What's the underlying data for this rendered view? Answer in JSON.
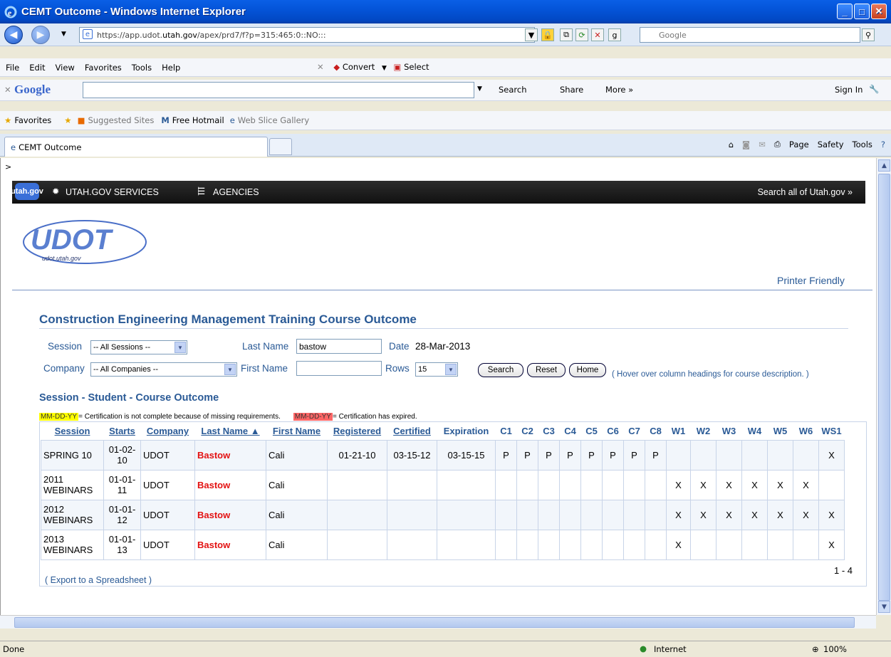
{
  "window": {
    "title": "CEMT Outcome - Windows Internet Explorer"
  },
  "address": {
    "url_prefix": "https://app.udot.",
    "url_host": "utah.gov",
    "url_rest": "/apex/prd7/f?p=315:465:0::NO:::",
    "google_placeholder": "Google"
  },
  "menu": {
    "items": [
      "File",
      "Edit",
      "View",
      "Favorites",
      "Tools",
      "Help"
    ],
    "convert": "Convert",
    "select": "Select"
  },
  "googlebar": {
    "logo": "Google",
    "search": "Search",
    "share": "Share",
    "more": "More »",
    "signin": "Sign In"
  },
  "favbar": {
    "favorites": "Favorites",
    "suggested": "Suggested Sites",
    "hotmail": "Free Hotmail",
    "webslice": "Web Slice Gallery"
  },
  "tabbar": {
    "tab_title": "CEMT Outcome",
    "page": "Page",
    "safety": "Safety",
    "tools": "Tools"
  },
  "utahbar": {
    "logo": "utah.gov",
    "services": "UTAH.GOV SERVICES",
    "agencies": "AGENCIES",
    "search_all": "Search all of Utah.gov »"
  },
  "header": {
    "logo_text": "UDOT",
    "logo_sub": "udot.utah.gov",
    "printer": "Printer Friendly",
    "breadcrumb": ">"
  },
  "page": {
    "title": "Construction Engineering Management Training Course Outcome"
  },
  "form": {
    "session_label": "Session",
    "session_value": "-- All Sessions --",
    "lastname_label": "Last Name",
    "lastname_value": "bastow",
    "date_label": "Date",
    "date_value": "28-Mar-2013",
    "company_label": "Company",
    "company_value": "-- All Companies --",
    "firstname_label": "First Name",
    "firstname_value": "",
    "rows_label": "Rows",
    "rows_value": "15",
    "search_btn": "Search",
    "reset_btn": "Reset",
    "home_btn": "Home",
    "hover_note": "( Hover over column headings for course description. )"
  },
  "region": {
    "title": "Session - Student - Course Outcome",
    "legend_yellow": "MM-DD-YY",
    "legend_yellow_text": " = Certification is not complete because of missing requirements.",
    "legend_red": "MM-DD-YY",
    "legend_red_text": " = Certification has expired."
  },
  "table": {
    "headers": [
      "Session",
      "Starts",
      "Company",
      "Last Name ▲",
      "First Name",
      "Registered",
      "Certified",
      "Expiration",
      "C1",
      "C2",
      "C3",
      "C4",
      "C5",
      "C6",
      "C7",
      "C8",
      "W1",
      "W2",
      "W3",
      "W4",
      "W5",
      "W6",
      "WS1"
    ],
    "rows": [
      [
        "SPRING 10",
        "01-02-10",
        "UDOT",
        "Bastow",
        "Cali",
        "01-21-10",
        "03-15-12",
        "03-15-15",
        "P",
        "P",
        "P",
        "P",
        "P",
        "P",
        "P",
        "P",
        "",
        "",
        "",
        "",
        "",
        "",
        "X"
      ],
      [
        "2011 WEBINARS",
        "01-01-11",
        "UDOT",
        "Bastow",
        "Cali",
        "",
        "",
        "",
        "",
        "",
        "",
        "",
        "",
        "",
        "",
        "",
        "X",
        "X",
        "X",
        "X",
        "X",
        "X",
        ""
      ],
      [
        "2012 WEBINARS",
        "01-01-12",
        "UDOT",
        "Bastow",
        "Cali",
        "",
        "",
        "",
        "",
        "",
        "",
        "",
        "",
        "",
        "",
        "",
        "X",
        "X",
        "X",
        "X",
        "X",
        "X",
        "X"
      ],
      [
        "2013 WEBINARS",
        "01-01-13",
        "UDOT",
        "Bastow",
        "Cali",
        "",
        "",
        "",
        "",
        "",
        "",
        "",
        "",
        "",
        "",
        "",
        "X",
        "",
        "",
        "",
        "",
        "",
        "X"
      ]
    ],
    "export": "( Export to a Spreadsheet )",
    "pagination": "1 - 4"
  },
  "status": {
    "done": "Done",
    "zone": "Internet",
    "zoom": "100%"
  },
  "colors": {
    "link": "#2a5a96",
    "lastname": "#e31212",
    "legend_yellow": "#ffff00",
    "legend_red": "#ff6666"
  }
}
